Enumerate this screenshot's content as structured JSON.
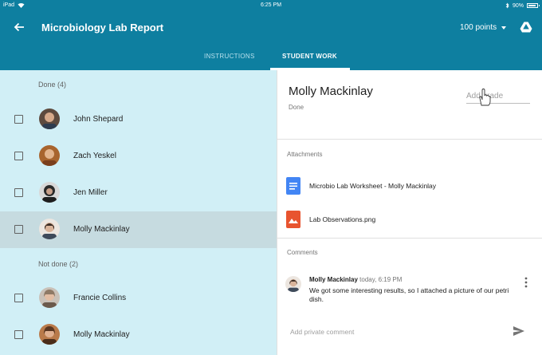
{
  "status_bar": {
    "device": "iPad",
    "time": "6:25 PM",
    "battery": "90%"
  },
  "app_bar": {
    "title": "Microbiology Lab Report",
    "points": "100 points",
    "tabs": [
      {
        "label": "INSTRUCTIONS",
        "active": false
      },
      {
        "label": "STUDENT WORK",
        "active": true
      }
    ]
  },
  "student_list": {
    "done_label": "Done (4)",
    "done": [
      {
        "name": "John Shepard"
      },
      {
        "name": "Zach Yeskel"
      },
      {
        "name": "Jen Miller"
      },
      {
        "name": "Molly Mackinlay",
        "selected": true
      }
    ],
    "not_done_label": "Not done (2)",
    "not_done": [
      {
        "name": "Francie Collins"
      },
      {
        "name": "Molly Mackinlay"
      }
    ]
  },
  "detail": {
    "student_name": "Molly Mackinlay",
    "status": "Done",
    "grade_placeholder": "Add grade",
    "attachments_label": "Attachments",
    "attachments": [
      {
        "label": "Microbio Lab Worksheet - Molly Mackinlay",
        "icon": "doc-icon"
      },
      {
        "label": "Lab Observations.png",
        "icon": "image-icon"
      }
    ],
    "comments_label": "Comments",
    "comment": {
      "author": "Molly Mackinlay",
      "time": "today, 6:19 PM",
      "text": "We got some interesting results, so I attached a picture of our petri dish."
    },
    "private_comment_placeholder": "Add private comment"
  },
  "colors": {
    "app_bar": "#0e7fa0",
    "list_bg": "#d1eff6",
    "selected_row": "#c6dbe0",
    "doc_icon": "#4285f4",
    "image_icon": "#e8542f"
  }
}
